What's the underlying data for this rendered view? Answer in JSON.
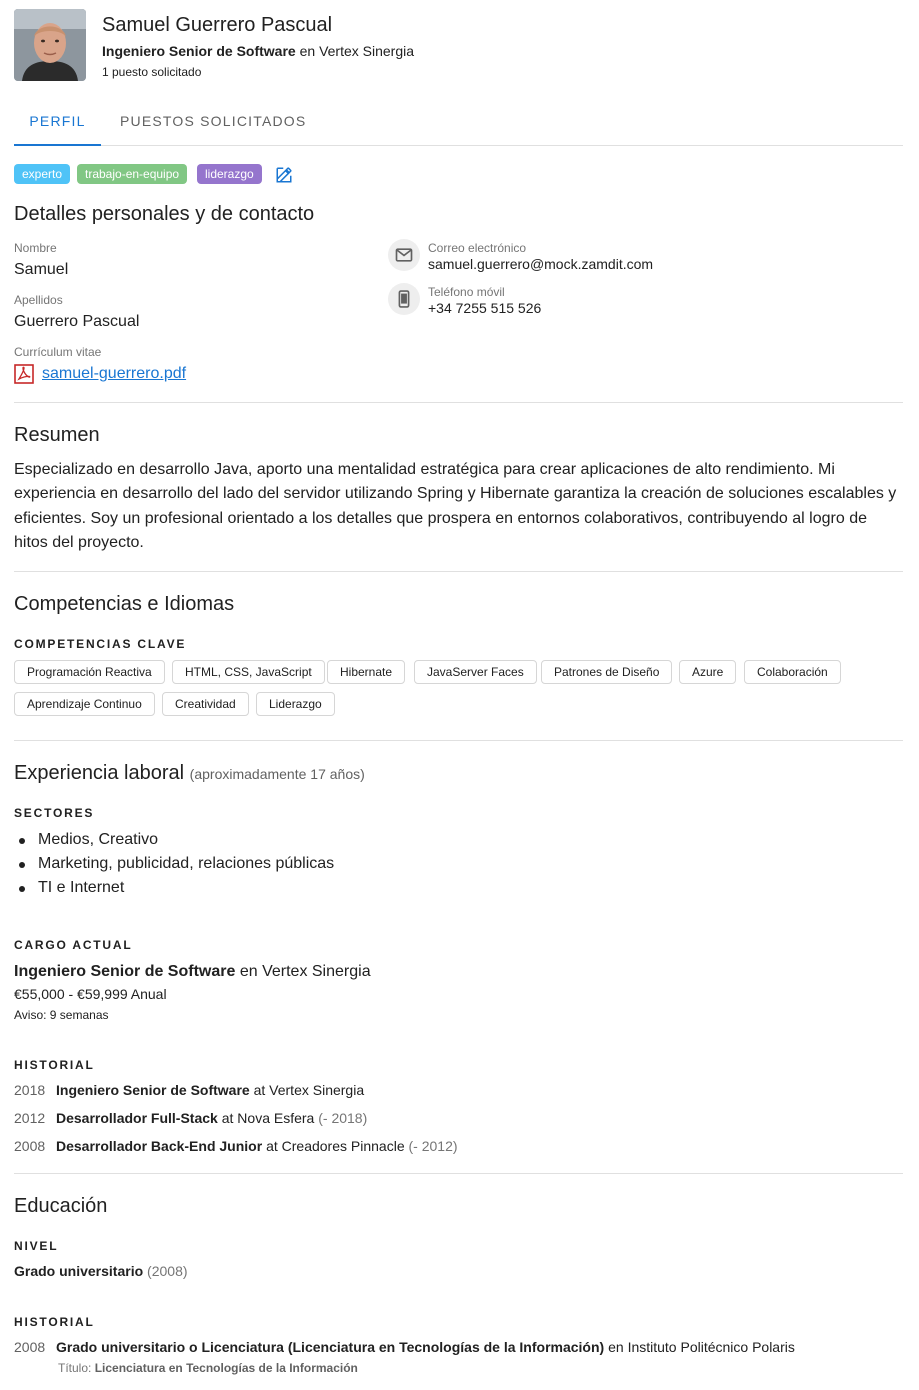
{
  "header": {
    "name": "Samuel Guerrero Pascual",
    "role_title": "Ingeniero Senior de Software",
    "role_connector": "en",
    "company": "Vertex Sinergia",
    "applied_count": "1 puesto solicitado"
  },
  "tabs": [
    {
      "label": "Perfil",
      "active": true
    },
    {
      "label": "Puestos solicitados",
      "active": false
    }
  ],
  "tags": [
    {
      "label": "experto",
      "color": "#4fc3f7"
    },
    {
      "label": "trabajo-en-equipo",
      "color": "#81c784"
    },
    {
      "label": "liderazgo",
      "color": "#9575cd"
    }
  ],
  "personal": {
    "title": "Detalles personales y de contacto",
    "first_name_label": "Nombre",
    "first_name": "Samuel",
    "last_name_label": "Apellidos",
    "last_name": "Guerrero Pascual",
    "cv_label": "Currículum vitae",
    "cv_file": "samuel-guerrero.pdf",
    "email_label": "Correo electrónico",
    "email": "samuel.guerrero@mock.zamdit.com",
    "phone_label": "Teléfono móvil",
    "phone": "+34 7255 515 526"
  },
  "summary": {
    "title": "Resumen",
    "text": "Especializado en desarrollo Java, aporto una mentalidad estratégica para crear aplicaciones de alto rendimiento. Mi experiencia en desarrollo del lado del servidor utilizando Spring y Hibernate garantiza la creación de soluciones escalables y eficientes. Soy un profesional orientado a los detalles que prospera en entornos colaborativos, contribuyendo al logro de hitos del proyecto."
  },
  "skills": {
    "title": "Competencias e Idiomas",
    "key_label": "COMPETENCIAS CLAVE",
    "items": [
      "Programación Reactiva",
      "HTML, CSS, JavaScript",
      "Hibernate",
      "JavaServer Faces",
      "Patrones de Diseño",
      "Azure",
      "Colaboración",
      "Aprendizaje Continuo",
      "Creatividad",
      "Liderazgo"
    ]
  },
  "experience": {
    "title": "Experiencia laboral",
    "years": "(aproximadamente 17 años)",
    "sectors_label": "SECTORES",
    "sectors": [
      "Medios, Creativo",
      "Marketing, publicidad, relaciones públicas",
      "TI e Internet"
    ],
    "current_label": "CARGO ACTUAL",
    "current_title": "Ingeniero Senior de Software",
    "current_connector": "en",
    "current_company": "Vertex Sinergia",
    "salary": "€55,000 - €59,999 Anual",
    "notice": "Aviso: 9 semanas",
    "history_label": "HISTORIAL",
    "history": [
      {
        "year": "2018",
        "title": "Ingeniero Senior de Software",
        "connector": "at",
        "company": "Vertex Sinergia",
        "end": ""
      },
      {
        "year": "2012",
        "title": "Desarrollador Full-Stack",
        "connector": "at",
        "company": "Nova Esfera",
        "end": "(- 2018)"
      },
      {
        "year": "2008",
        "title": "Desarrollador Back-End Junior",
        "connector": "at",
        "company": "Creadores Pinnacle",
        "end": "(- 2012)"
      }
    ]
  },
  "education": {
    "title": "Educación",
    "level_label": "NIVEL",
    "level": "Grado universitario",
    "level_year": "(2008)",
    "history_label": "HISTORIAL",
    "history": [
      {
        "year": "2008",
        "degree": "Grado universitario o Licenciatura (Licenciatura en Tecnologías de la Información)",
        "connector": "en",
        "institution": "Instituto Politécnico Polaris",
        "title_label": "Título:",
        "title_value": "Licenciatura en Tecnologías de la Información"
      }
    ]
  }
}
